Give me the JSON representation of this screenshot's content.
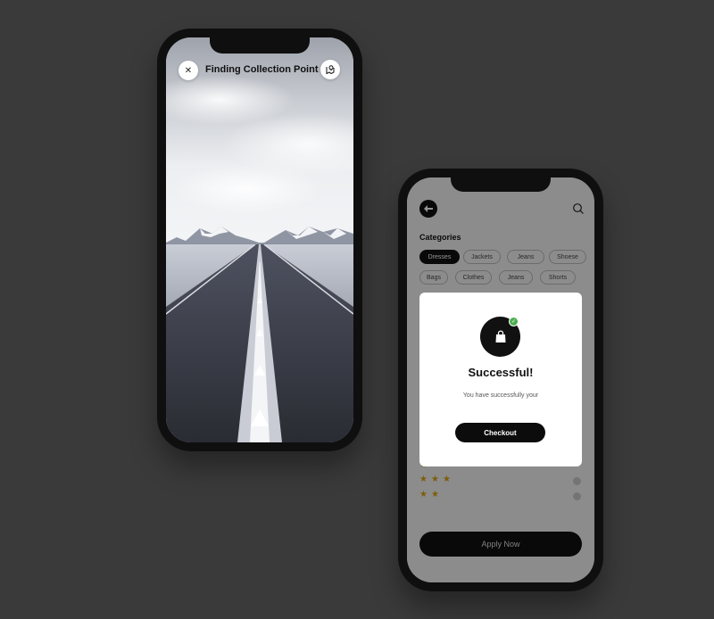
{
  "navigation_screen": {
    "title": "Finding Collection Point",
    "close_icon": "close-icon",
    "map_icon": "map-pin-icon"
  },
  "filter_screen": {
    "back_icon": "back-arrow-icon",
    "search_icon": "search-icon",
    "categories_title": "Categories",
    "chips_row1": [
      "Dresses",
      "Jackets",
      "Jeans",
      "Shoese"
    ],
    "chips_row2": [
      "Bags",
      "Clothes",
      "Jeans",
      "Shorts"
    ],
    "active_chip": "Dresses",
    "ratings_visible": [
      3,
      2
    ],
    "apply_label": "Apply Now",
    "accent_star_color": "#d9a011"
  },
  "modal": {
    "icon": "shopping-bag-icon",
    "badge_icon": "check-icon",
    "title": "Successful!",
    "message": "You have successfully your",
    "button_label": "Checkout",
    "badge_color": "#4caf50"
  }
}
